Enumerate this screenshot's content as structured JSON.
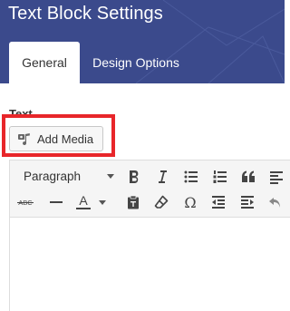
{
  "panel": {
    "title": "Text Block Settings"
  },
  "tabs": [
    {
      "label": "General",
      "active": true
    },
    {
      "label": "Design Options",
      "active": false
    }
  ],
  "field": {
    "label": "Text"
  },
  "add_media": {
    "label": "Add Media"
  },
  "editor": {
    "format_select": {
      "selected": "Paragraph"
    },
    "toolbar_row1": [
      "bold-icon",
      "italic-icon",
      "bulleted-list-icon",
      "numbered-list-icon",
      "blockquote-icon",
      "align-left-icon"
    ],
    "toolbar_row2": [
      "strikethrough-icon",
      "horizontal-line-icon",
      "text-color-icon",
      "paste-as-text-icon",
      "clear-formatting-icon",
      "special-character-icon",
      "decrease-indent-icon",
      "increase-indent-icon",
      "undo-icon"
    ],
    "glyphs": {
      "strikethrough": "ABC",
      "text_color": "A",
      "omega": "Ω"
    }
  },
  "colors": {
    "header_bg": "#3b4a8c",
    "highlight_border": "#e8262a"
  }
}
